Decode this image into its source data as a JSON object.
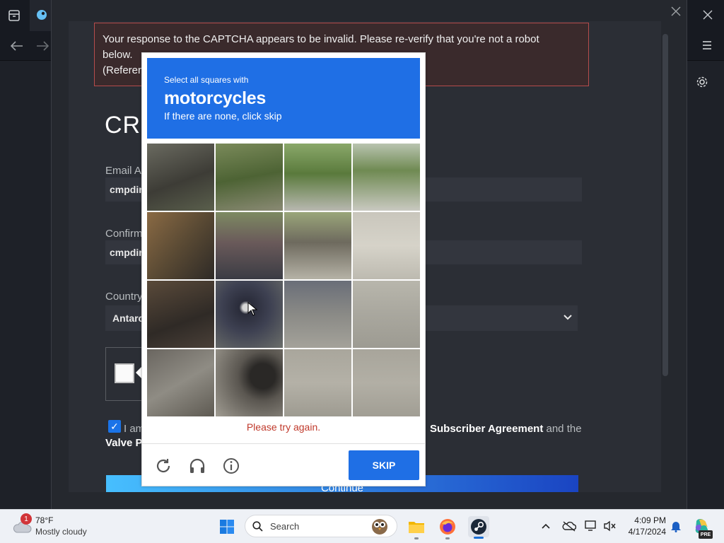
{
  "client": {
    "icons": [
      "archive-icon",
      "steam-icon",
      "back-arrow-icon",
      "forward-arrow-icon",
      "close-icon",
      "menu-icon",
      "settings-gear-icon"
    ]
  },
  "error": {
    "line1": "Your response to the CAPTCHA appears to be invalid. Please re-verify that you're not a robot",
    "line2": "below.",
    "line3": "(Referen"
  },
  "form": {
    "title": "CRI",
    "email_label": "Email Ad",
    "email_value": "cmpdir",
    "confirm_label": "Confirm",
    "confirm_value": "cmpdir",
    "country_label": "Country",
    "country_value": "Antarc",
    "agree_prefix": "I am",
    "agree_link": "Subscriber Agreement",
    "agree_and": "and the",
    "agree_line2": "Valve Pr",
    "agree_partial": "n",
    "continue_label": "Continue"
  },
  "captcha": {
    "prompt_small": "Select all squares with",
    "prompt_target": "motorcycles",
    "prompt_hint": "If there are none, click skip",
    "error": "Please try again.",
    "skip_label": "SKIP",
    "tiles_count": 16
  },
  "taskbar": {
    "weather_temp": "78°F",
    "weather_desc": "Mostly cloudy",
    "weather_badge": "1",
    "search_placeholder": "Search",
    "time": "4:09 PM",
    "date": "4/17/2024",
    "copilot_badge": "PRE"
  }
}
